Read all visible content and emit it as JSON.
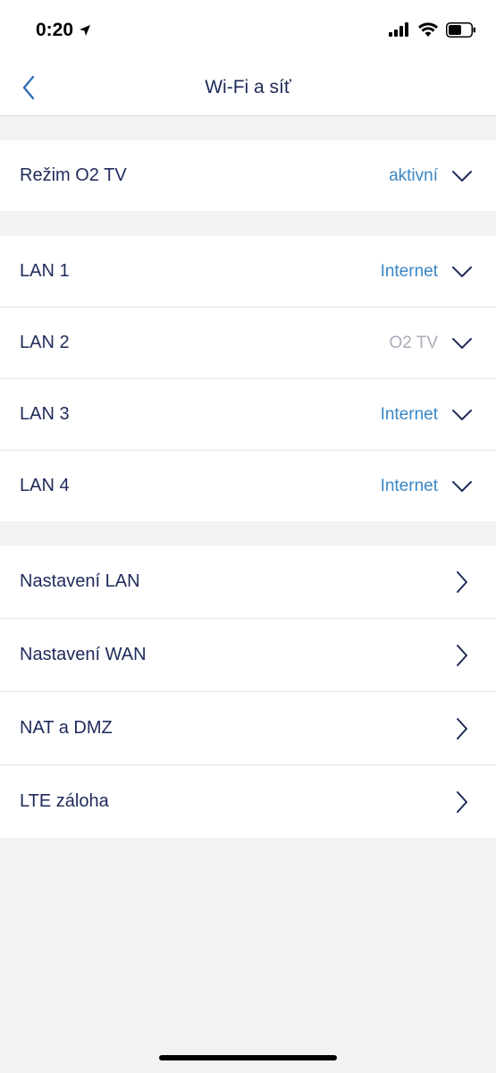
{
  "status": {
    "time": "0:20"
  },
  "header": {
    "title": "Wi-Fi a síť"
  },
  "tv_mode": {
    "label": "Režim O2 TV",
    "value": "aktivní"
  },
  "lan_ports": [
    {
      "label": "LAN 1",
      "value": "Internet"
    },
    {
      "label": "LAN 2",
      "value": "O2 TV"
    },
    {
      "label": "LAN 3",
      "value": "Internet"
    },
    {
      "label": "LAN 4",
      "value": "Internet"
    }
  ],
  "settings": [
    {
      "label": "Nastavení LAN"
    },
    {
      "label": "Nastavení WAN"
    },
    {
      "label": "NAT a DMZ"
    },
    {
      "label": "LTE záloha"
    }
  ],
  "colors": {
    "accent": "#3a86c4",
    "text": "#1e2a5a",
    "muted": "#a9adb8",
    "background": "#f2f2f2"
  },
  "icons": {
    "back": "chevron-left-icon",
    "dropdown": "chevron-down-icon",
    "navigate": "chevron-right-icon"
  }
}
